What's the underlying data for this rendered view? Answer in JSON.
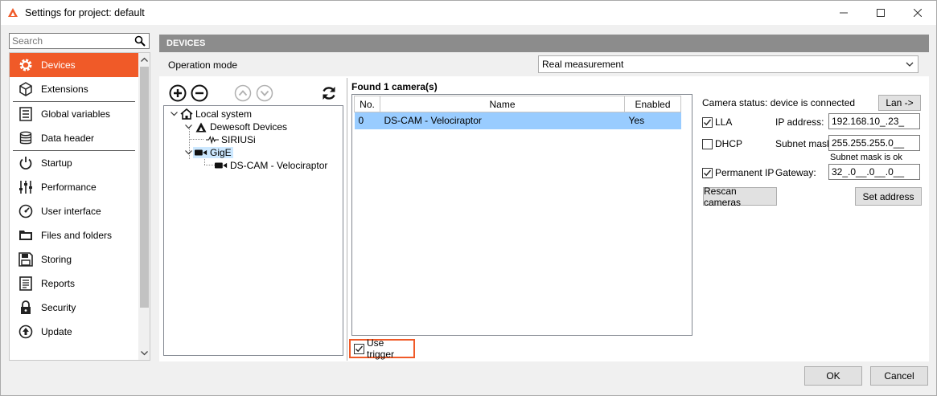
{
  "window": {
    "title": "Settings for project: default",
    "accent_color": "#f05a28"
  },
  "search": {
    "placeholder": "Search"
  },
  "sidebar": {
    "items": [
      {
        "label": "Devices",
        "icon": "gear-icon",
        "active": true
      },
      {
        "label": "Extensions",
        "icon": "cube-icon"
      },
      {
        "label": "Global variables",
        "icon": "list-icon"
      },
      {
        "label": "Data header",
        "icon": "database-icon"
      },
      {
        "label": "Startup",
        "icon": "power-icon"
      },
      {
        "label": "Performance",
        "icon": "sliders-icon"
      },
      {
        "label": "User interface",
        "icon": "speedometer-icon"
      },
      {
        "label": "Files and folders",
        "icon": "folders-icon"
      },
      {
        "label": "Storing",
        "icon": "floppy-icon"
      },
      {
        "label": "Reports",
        "icon": "report-icon"
      },
      {
        "label": "Security",
        "icon": "lock-icon"
      },
      {
        "label": "Update",
        "icon": "update-icon"
      }
    ]
  },
  "main": {
    "header": "DEVICES",
    "operation_mode_label": "Operation mode",
    "operation_mode_value": "Real measurement"
  },
  "tree": {
    "local_system": "Local system",
    "dewesoft_devices": "Dewesoft Devices",
    "sirius": "SIRIUSi",
    "gige": "GigE",
    "camera": "DS-CAM - Velociraptor"
  },
  "cameras": {
    "found_label": "Found 1 camera(s)",
    "columns": [
      "No.",
      "Name",
      "Enabled"
    ],
    "rows": [
      {
        "no": "0",
        "name": "DS-CAM - Velociraptor",
        "enabled": "Yes"
      }
    ],
    "use_trigger_label": "Use trigger"
  },
  "camera_settings": {
    "status": "Camera status: device is connected",
    "lan_button": "Lan ->",
    "lla_label": "LLA",
    "dhcp_label": "DHCP",
    "permanent_ip_label": "Permanent IP",
    "ip_label": "IP address:",
    "ip_value": "192.168.10_.23_",
    "subnet_label": "Subnet mask:",
    "subnet_value": "255.255.255.0__",
    "subnet_status": "Subnet mask is ok",
    "gateway_label": "Gateway:",
    "gateway_value": "32_.0__.0__.0__",
    "rescan_button": "Rescan cameras",
    "set_address_button": "Set address"
  },
  "footer": {
    "ok": "OK",
    "cancel": "Cancel"
  }
}
